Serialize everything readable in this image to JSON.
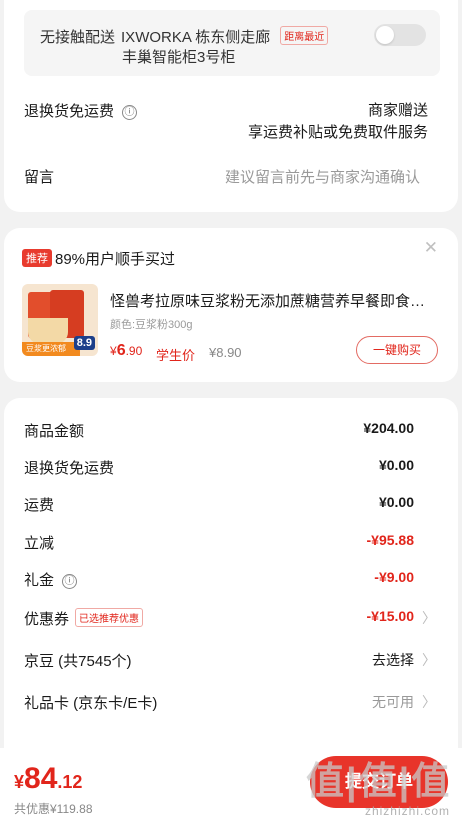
{
  "delivery": {
    "method": "无接触配送",
    "address_line1": "IXWORKA 栋东侧走廊",
    "address_line2": "丰巢智能柜3号柜",
    "distance_tag": "距离最近",
    "toggle_on": false
  },
  "return_shipping": {
    "label": "退换货免运费",
    "info_icon": "ⓘ",
    "value_line1": "商家赠送",
    "value_line2": "享运费补贴或免费取件服务"
  },
  "message": {
    "label": "留言",
    "placeholder": "建议留言前先与商家沟通确认"
  },
  "recommend": {
    "badge": "推荐",
    "headline": "89%用户顺手买过",
    "close_glyph": "✕",
    "product": {
      "title": "怪兽考拉原味豆浆粉无添加蔗糖营养早餐即食…",
      "spec": "颜色:豆浆粉300g",
      "price_currency": "¥",
      "price_int": "6",
      "price_dec": ".90",
      "price_label": "学生价",
      "original_price": "¥8.90",
      "image_badge": "8.9",
      "image_ribbon": "豆浆更浓郁",
      "buy_label": "一键购买"
    }
  },
  "amounts": [
    {
      "label": "商品金额",
      "value": "¥204.00"
    },
    {
      "label": "退换货免运费",
      "value": "¥0.00"
    },
    {
      "label": "运费",
      "value": "¥0.00"
    },
    {
      "label": "立减",
      "value": "-¥95.88"
    },
    {
      "label": "礼金",
      "value": "-¥9.00"
    },
    {
      "label": "优惠券",
      "tag": "已选推荐优惠",
      "value": "-¥15.00"
    },
    {
      "label": "京豆 (共7545个)",
      "value": "去选择"
    },
    {
      "label": "礼品卡 (京东卡/E卡)",
      "value": "无可用"
    }
  ],
  "footer": {
    "currency": "¥",
    "total_int": "84",
    "total_dec": ".12",
    "saved": "共优惠¥119.88",
    "submit_label": "提交订单",
    "watermark_logo": "值|值|值",
    "watermark_url": "zhizhizhi.com"
  },
  "colors": {
    "accent": "#e1251b",
    "background": "#f2f2f2"
  }
}
